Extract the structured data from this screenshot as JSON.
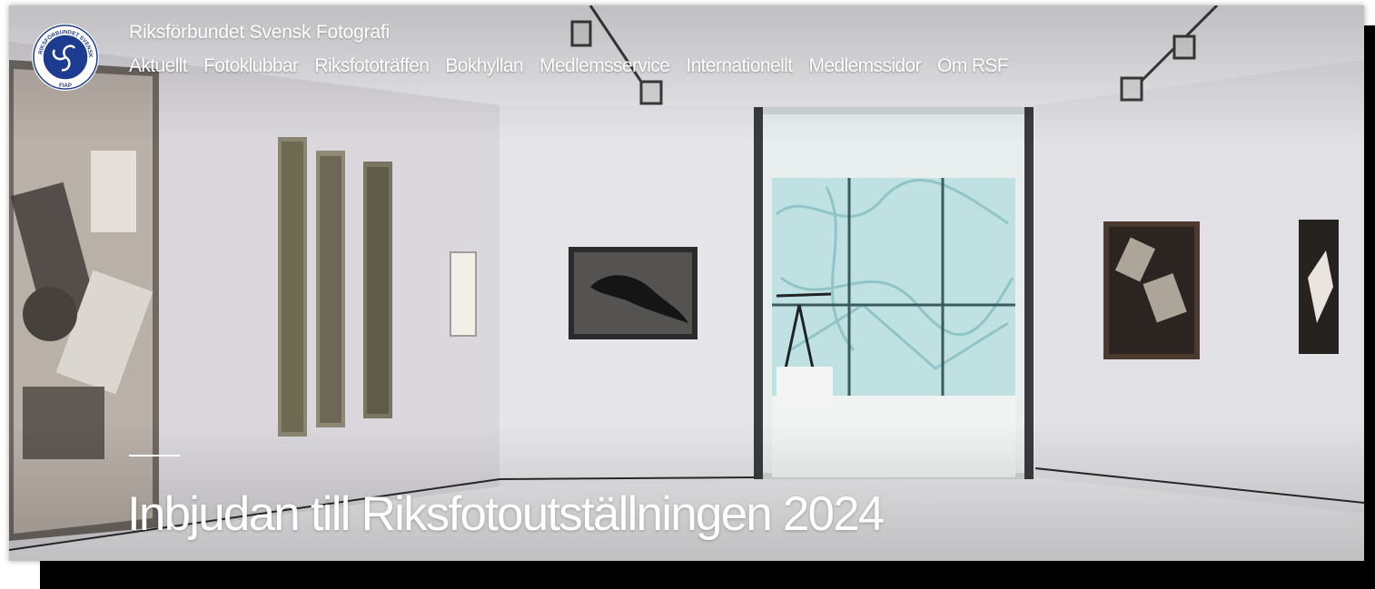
{
  "site": {
    "title": "Riksförbundet Svensk Fotografi",
    "logo_text_top": "RIKSFÖRBUNDET SVENSK FOTOGRAFI",
    "logo_text_bottom": "FIAP"
  },
  "nav": {
    "items": [
      {
        "label": "Aktuellt"
      },
      {
        "label": "Fotoklubbar"
      },
      {
        "label": "Riksfototräffen"
      },
      {
        "label": "Bokhyllan"
      },
      {
        "label": "Medlemsservice"
      },
      {
        "label": "Internationellt"
      },
      {
        "label": "Medlemssidor"
      },
      {
        "label": "Om RSF"
      }
    ]
  },
  "hero": {
    "headline": "Inbjudan till Riksfotoutställningen 2024",
    "background_image": "art-gallery-interior"
  },
  "colors": {
    "logo_blue": "#1d3c8f",
    "text": "#ffffff",
    "frame_shadow": "#000000"
  }
}
